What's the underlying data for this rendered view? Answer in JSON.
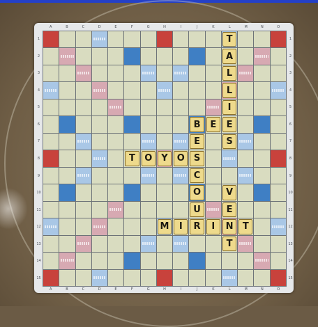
{
  "board": {
    "columns": [
      "A",
      "B",
      "C",
      "D",
      "E",
      "F",
      "G",
      "H",
      "I",
      "J",
      "K",
      "L",
      "M",
      "N",
      "O"
    ],
    "rows": [
      "1",
      "2",
      "3",
      "4",
      "5",
      "6",
      "7",
      "8",
      "9",
      "10",
      "11",
      "12",
      "13",
      "14",
      "15"
    ],
    "premium_colors": {
      "triple_word": "#c8423c",
      "double_word": "#d7a9b2",
      "triple_letter": "#3f7fc4",
      "double_letter": "#a9c7e6",
      "plain": "#d9dcc0",
      "tile": "#eeda8c"
    },
    "tiles": [
      {
        "row": 1,
        "col": 12,
        "letter": "T"
      },
      {
        "row": 2,
        "col": 12,
        "letter": "A"
      },
      {
        "row": 3,
        "col": 12,
        "letter": "L"
      },
      {
        "row": 4,
        "col": 12,
        "letter": "L"
      },
      {
        "row": 5,
        "col": 12,
        "letter": "I"
      },
      {
        "row": 6,
        "col": 12,
        "letter": "E"
      },
      {
        "row": 7,
        "col": 12,
        "letter": "S"
      },
      {
        "row": 6,
        "col": 10,
        "letter": "B"
      },
      {
        "row": 6,
        "col": 11,
        "letter": "E"
      },
      {
        "row": 7,
        "col": 10,
        "letter": "E"
      },
      {
        "row": 8,
        "col": 10,
        "letter": "S"
      },
      {
        "row": 9,
        "col": 10,
        "letter": "C"
      },
      {
        "row": 10,
        "col": 10,
        "letter": "O"
      },
      {
        "row": 11,
        "col": 10,
        "letter": "U"
      },
      {
        "row": 12,
        "col": 10,
        "letter": "R"
      },
      {
        "row": 8,
        "col": 6,
        "letter": "T"
      },
      {
        "row": 8,
        "col": 7,
        "letter": "O"
      },
      {
        "row": 8,
        "col": 8,
        "letter": "Y"
      },
      {
        "row": 8,
        "col": 9,
        "letter": "O"
      },
      {
        "row": 12,
        "col": 8,
        "letter": "M"
      },
      {
        "row": 12,
        "col": 9,
        "letter": "I"
      },
      {
        "row": 12,
        "col": 11,
        "letter": "I"
      },
      {
        "row": 12,
        "col": 12,
        "letter": "N"
      },
      {
        "row": 12,
        "col": 13,
        "letter": "T"
      },
      {
        "row": 10,
        "col": 12,
        "letter": "V"
      },
      {
        "row": 11,
        "col": 12,
        "letter": "E"
      },
      {
        "row": 13,
        "col": 12,
        "letter": "T"
      }
    ]
  }
}
